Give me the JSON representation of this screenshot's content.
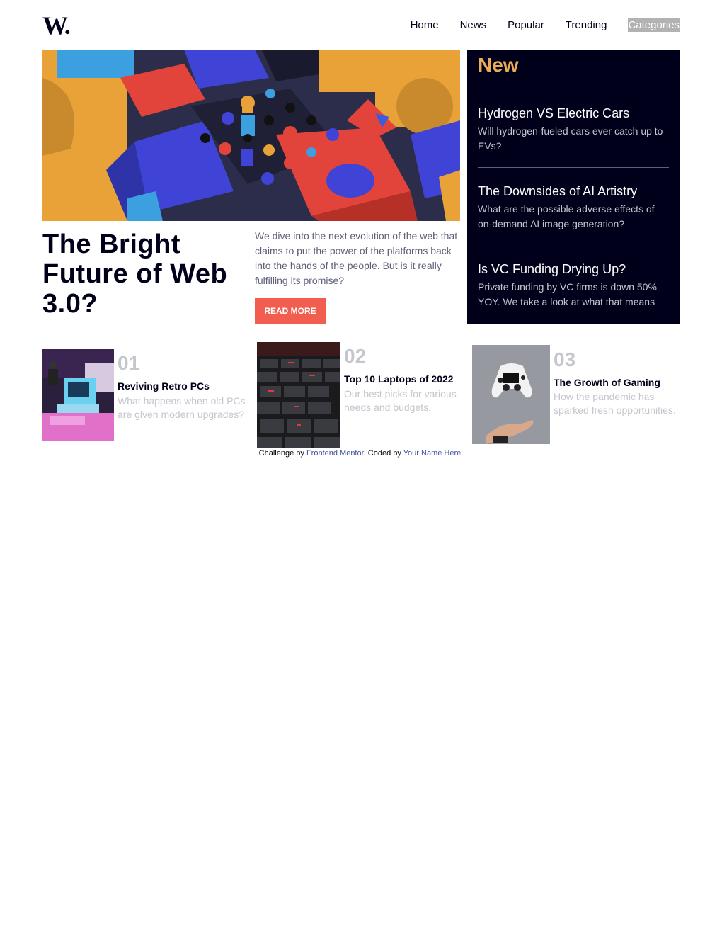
{
  "header": {
    "logo": "W.",
    "nav": [
      {
        "label": "Home"
      },
      {
        "label": "News"
      },
      {
        "label": "Popular"
      },
      {
        "label": "Trending"
      },
      {
        "label": "Categories"
      }
    ]
  },
  "hero": {
    "title": "The Bright Future of Web 3.0?",
    "description": "We dive into the next evolution of the web that claims to put the power of the platforms back into the hands of the people. But is it really fulfilling its promise?",
    "button_label": "READ MORE"
  },
  "new_panel": {
    "heading": "New",
    "items": [
      {
        "title": "Hydrogen VS Electric Cars",
        "text": "Will hydrogen-fueled cars ever catch up to EVs?"
      },
      {
        "title": "The Downsides of AI Artistry",
        "text": "What are the possible adverse effects of on-demand AI image generation?"
      },
      {
        "title": "Is VC Funding Drying Up?",
        "text": "Private funding by VC firms is down 50% YOY. We take a look at what that means"
      }
    ]
  },
  "cards": [
    {
      "number": "01",
      "title": "Reviving Retro PCs",
      "text": "What happens when old PCs are given modern upgrades?"
    },
    {
      "number": "02",
      "title": "Top 10 Laptops of 2022",
      "text": "Our best picks for various needs and budgets."
    },
    {
      "number": "03",
      "title": "The Growth of Gaming",
      "text": "How the pandemic has sparked fresh opportunities."
    }
  ],
  "footer": {
    "prefix": "Challenge by ",
    "link1": "Frontend Mentor",
    "middle": ". Coded by ",
    "link2": "Your Name Here",
    "suffix": "."
  },
  "colors": {
    "accent": "#f15e50",
    "new_heading": "#e9ab53",
    "dark": "#00001a",
    "muted": "#c5c6ce",
    "body_text": "#5d5f79"
  }
}
